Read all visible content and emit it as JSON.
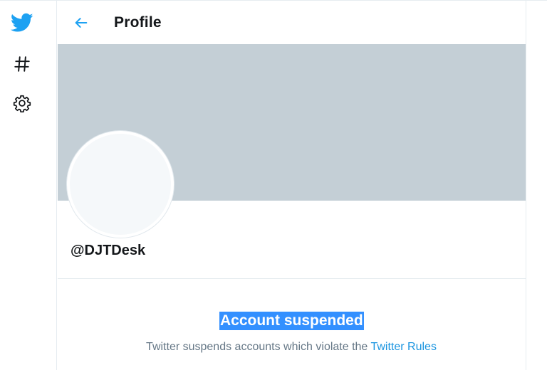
{
  "colors": {
    "brand": "#1da1f2",
    "link": "#1b95e0",
    "banner": "#c4cfd6",
    "selection": "#3390ff",
    "muted_text": "#657786"
  },
  "nav": {
    "items": [
      {
        "icon": "twitter-bird-icon"
      },
      {
        "icon": "hashtag-icon"
      },
      {
        "icon": "gear-icon"
      }
    ]
  },
  "header": {
    "back_icon": "back-arrow-icon",
    "title": "Profile"
  },
  "profile": {
    "handle": "@DJTDesk"
  },
  "suspension": {
    "title": "Account suspended",
    "message_prefix": "Twitter suspends accounts which violate the ",
    "rules_link": "Twitter Rules"
  }
}
